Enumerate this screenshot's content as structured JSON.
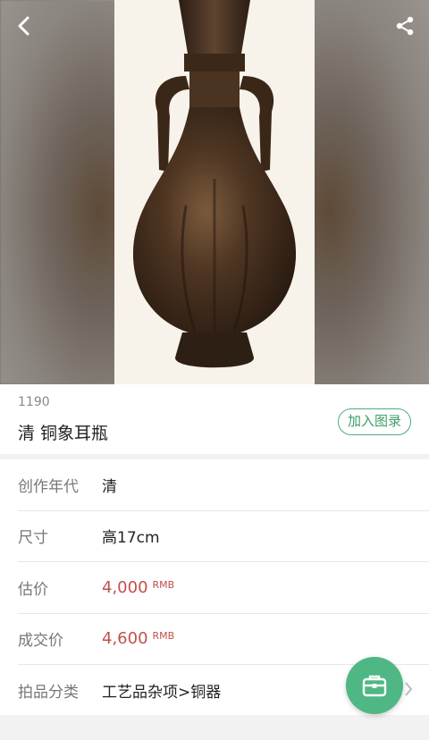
{
  "header": {
    "back_icon": "back-arrow-icon",
    "share_icon": "share-icon"
  },
  "lot": {
    "number": "1190",
    "title": "清 铜象耳瓶",
    "add_button": "加入图录"
  },
  "details": [
    {
      "label": "创作年代",
      "value": "清"
    },
    {
      "label": "尺寸",
      "value": "高17cm"
    },
    {
      "label": "估价",
      "value": "4,000",
      "unit": "RMB"
    },
    {
      "label": "成交价",
      "value": "4,600",
      "unit": "RMB"
    },
    {
      "label": "拍品分类",
      "value": "工艺品杂项>铜器"
    }
  ],
  "colors": {
    "accent": "#4fb783",
    "price": "#c0504d"
  },
  "fab": {
    "icon": "briefcase-icon"
  }
}
